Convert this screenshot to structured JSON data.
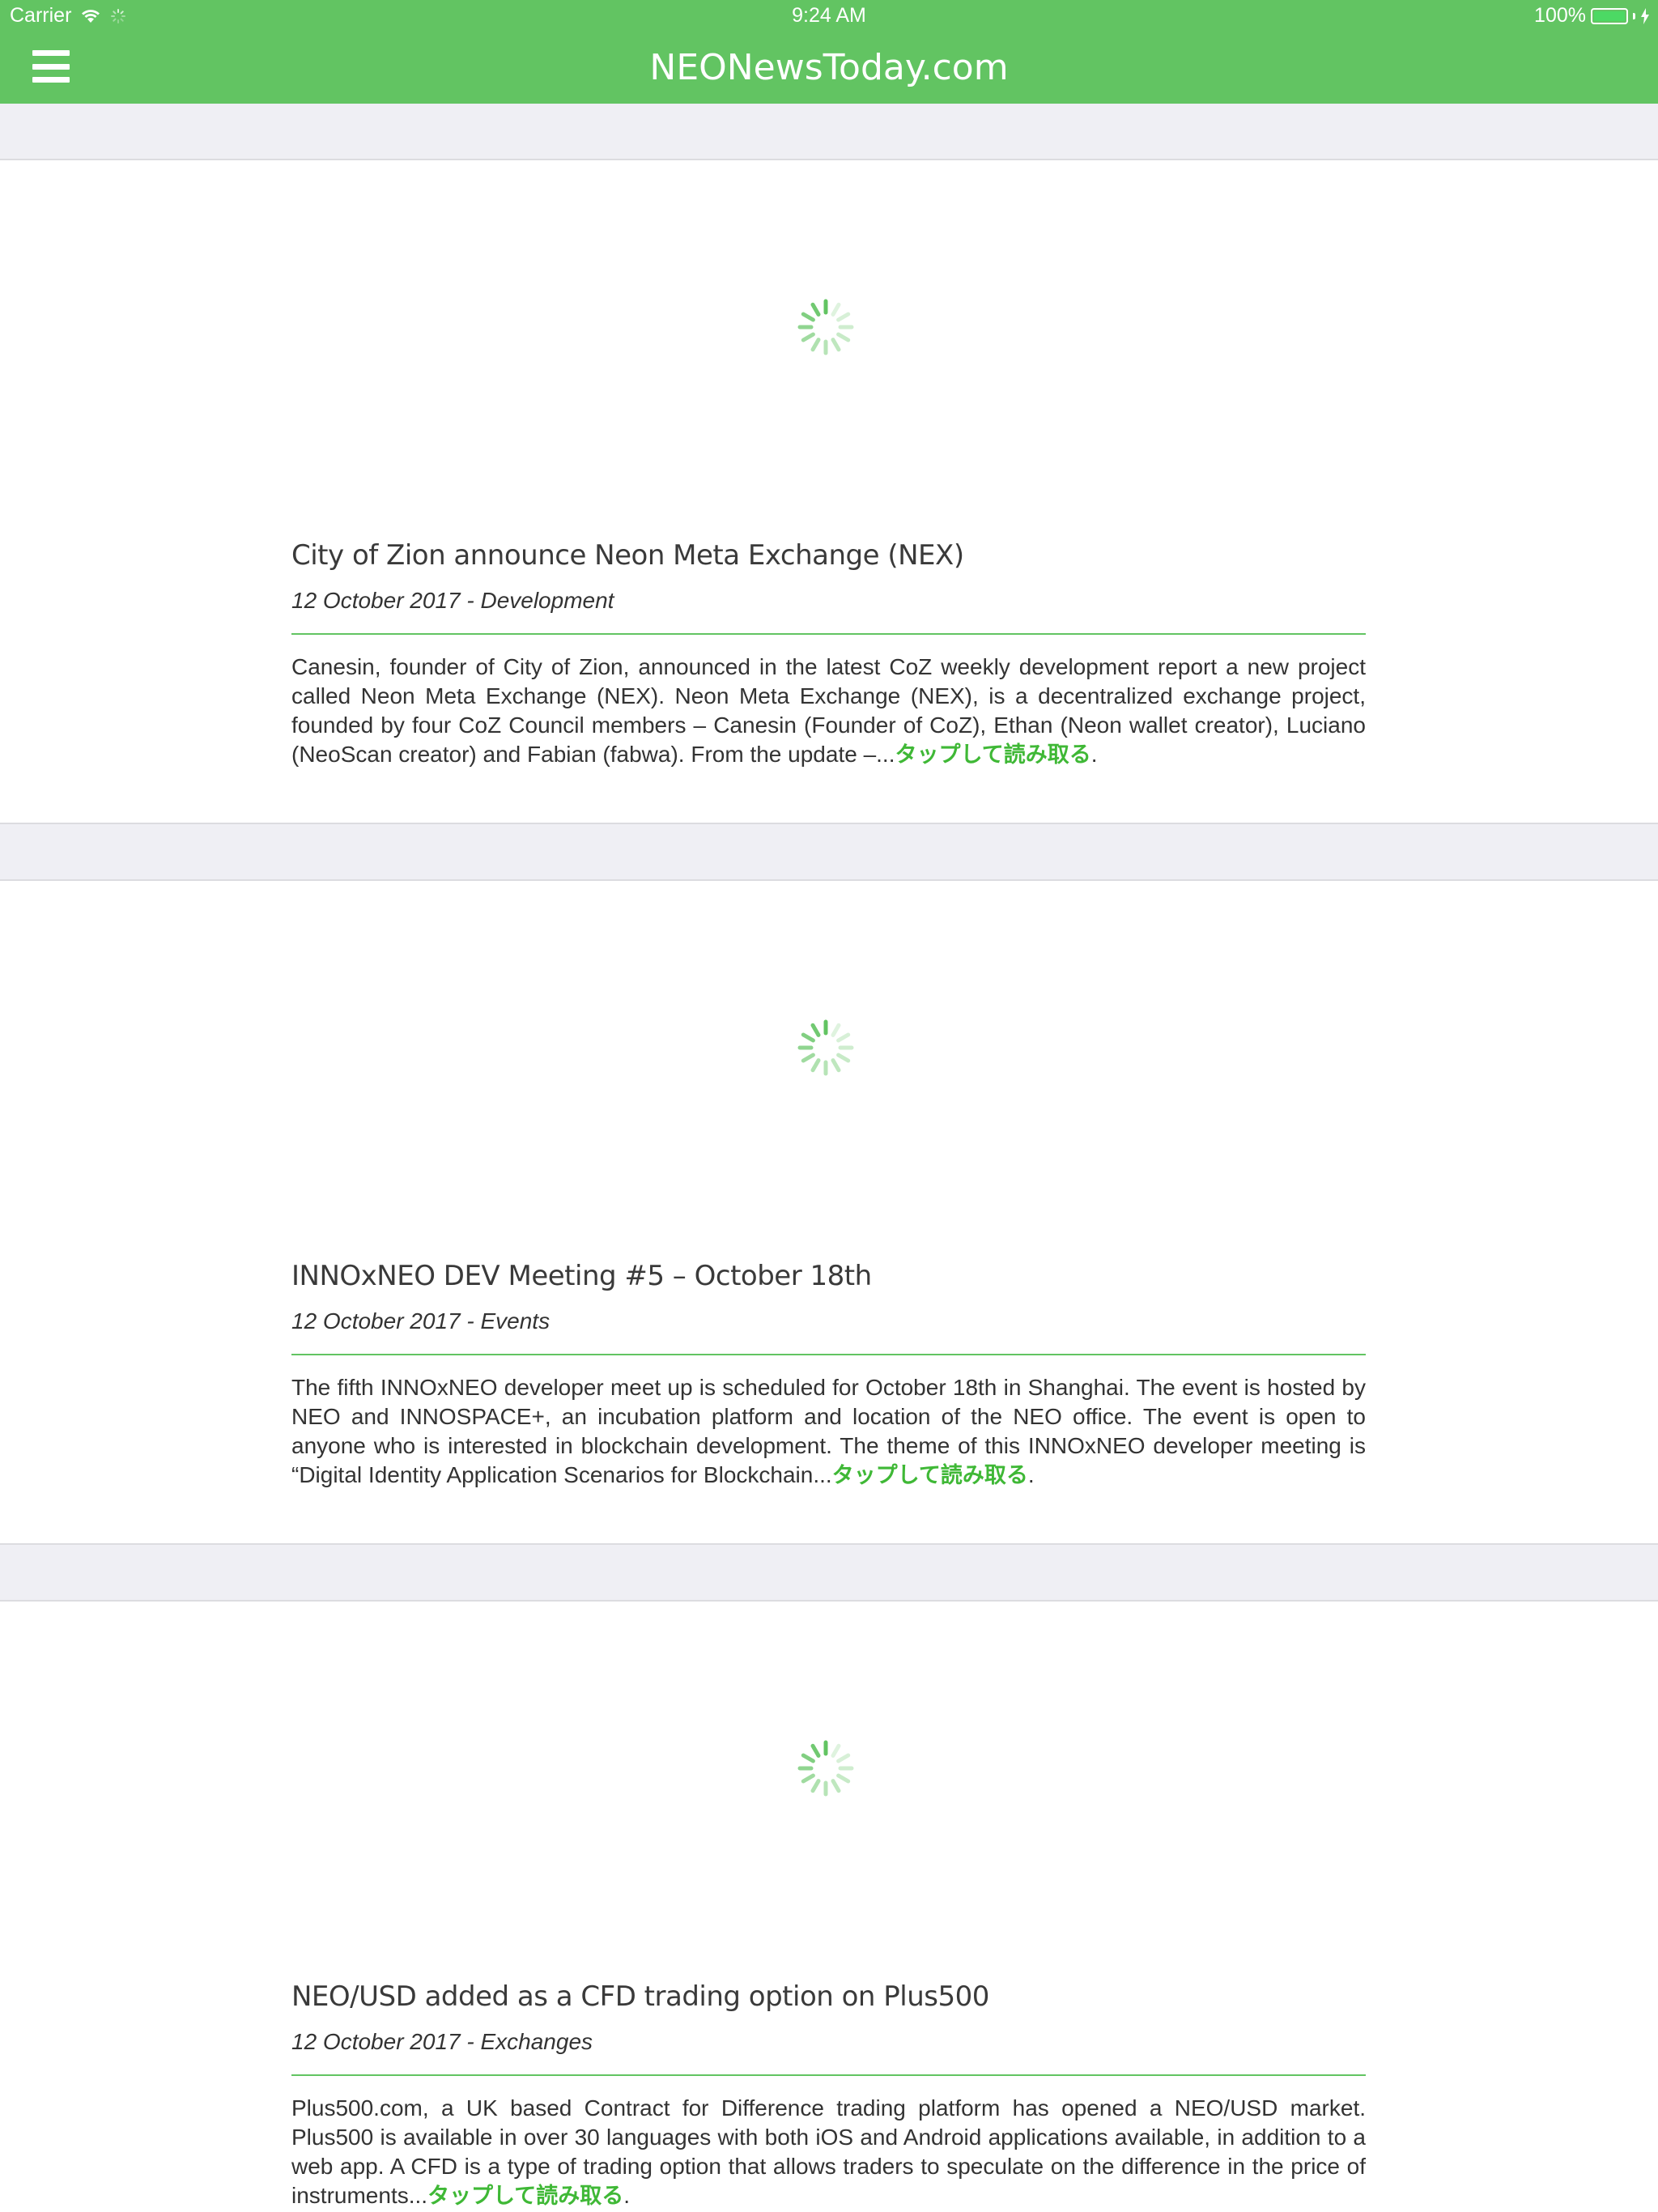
{
  "status_bar": {
    "carrier": "Carrier",
    "time": "9:24 AM",
    "battery": "100%"
  },
  "nav": {
    "title": "NEONewsToday.com",
    "menu_icon": "hamburger-icon"
  },
  "colors": {
    "brand_green": "#62c462",
    "link_green": "#3fb836",
    "background": "#efeff4"
  },
  "articles": [
    {
      "title": "City of Zion announce Neon Meta Exchange (NEX)",
      "meta": "12 October 2017 - Development",
      "excerpt": "Canesin, founder of City of Zion, announced in the latest CoZ weekly development report a new project called Neon Meta Exchange (NEX). Neon Meta Exchange (NEX), is a decentralized exchange project, founded by four CoZ Council members – Canesin (Founder of CoZ), Ethan (Neon wallet creator), Luciano (NeoScan creator) and Fabian (fabwa). From the update –...",
      "read_more": "タップして読み取る",
      "trail": "."
    },
    {
      "title": "INNOxNEO DEV Meeting #5 – October 18th",
      "meta": "12 October 2017 - Events",
      "excerpt": "The fifth INNOxNEO developer meet up is scheduled for October 18th in Shanghai. The event is hosted by NEO and INNOSPACE+, an incubation platform and location of the NEO office. The event is open to anyone who is interested in blockchain development. The theme of this INNOxNEO developer meeting is “Digital Identity Application Scenarios for Blockchain...",
      "read_more": "タップして読み取る",
      "trail": "."
    },
    {
      "title": "NEO/USD added as a CFD trading option on Plus500",
      "meta": "12 October 2017 - Exchanges",
      "excerpt": "Plus500.com, a UK based Contract for Difference trading platform has opened a NEO/USD market. Plus500 is available in over 30 languages with both iOS and Android applications available, in addition to a web app. A CFD is a type of trading option that allows traders to speculate on the difference in the price of instruments...",
      "read_more": "タップして読み取る",
      "trail": "."
    }
  ]
}
